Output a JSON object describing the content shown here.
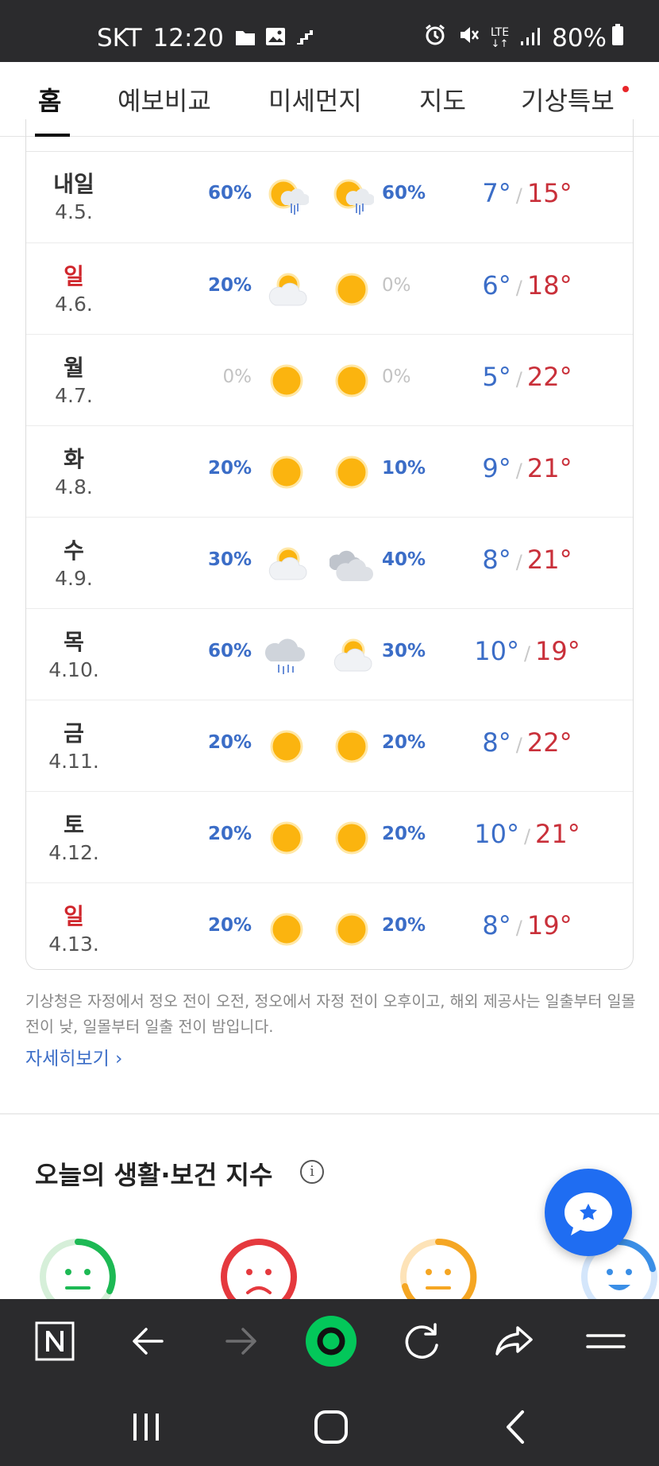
{
  "status_bar": {
    "carrier": "SKT",
    "time": "12:20",
    "network": "LTE",
    "battery": "80%"
  },
  "tabs": [
    {
      "label": "홈",
      "active": true
    },
    {
      "label": "예보비교",
      "active": false
    },
    {
      "label": "미세먼지",
      "active": false
    },
    {
      "label": "지도",
      "active": false
    },
    {
      "label": "기상특보",
      "active": false,
      "has_alert_dot": true
    }
  ],
  "forecast": {
    "rows": [
      {
        "day": "내일",
        "date": "4.5.",
        "am_pct": "60%",
        "am_icon": "cloud-rain-sun-icon",
        "pm_pct": "60%",
        "pm_icon": "cloud-rain-sun-icon",
        "low": "7°",
        "high": "15°",
        "holiday": false
      },
      {
        "day": "일",
        "date": "4.6.",
        "am_pct": "20%",
        "am_icon": "partly-cloudy-icon",
        "pm_pct": "0%",
        "pm_icon": "sun-icon",
        "low": "6°",
        "high": "18°",
        "holiday": true
      },
      {
        "day": "월",
        "date": "4.7.",
        "am_pct": "0%",
        "am_icon": "sun-icon",
        "pm_pct": "0%",
        "pm_icon": "sun-icon",
        "low": "5°",
        "high": "22°",
        "holiday": false
      },
      {
        "day": "화",
        "date": "4.8.",
        "am_pct": "20%",
        "am_icon": "sun-icon",
        "pm_pct": "10%",
        "pm_icon": "sun-icon",
        "low": "9°",
        "high": "21°",
        "holiday": false
      },
      {
        "day": "수",
        "date": "4.9.",
        "am_pct": "30%",
        "am_icon": "partly-cloudy-icon",
        "pm_pct": "40%",
        "pm_icon": "cloudy-icon",
        "low": "8°",
        "high": "21°",
        "holiday": false
      },
      {
        "day": "목",
        "date": "4.10.",
        "am_pct": "60%",
        "am_icon": "rain-icon",
        "pm_pct": "30%",
        "pm_icon": "partly-cloudy-icon",
        "low": "10°",
        "high": "19°",
        "holiday": false
      },
      {
        "day": "금",
        "date": "4.11.",
        "am_pct": "20%",
        "am_icon": "sun-icon",
        "pm_pct": "20%",
        "pm_icon": "sun-icon",
        "low": "8°",
        "high": "22°",
        "holiday": false
      },
      {
        "day": "토",
        "date": "4.12.",
        "am_pct": "20%",
        "am_icon": "sun-icon",
        "pm_pct": "20%",
        "pm_icon": "sun-icon",
        "low": "10°",
        "high": "21°",
        "holiday": false
      },
      {
        "day": "일",
        "date": "4.13.",
        "am_pct": "20%",
        "am_icon": "sun-icon",
        "pm_pct": "20%",
        "pm_icon": "sun-icon",
        "low": "8°",
        "high": "19°",
        "holiday": true
      }
    ],
    "note": "기상청은 자정에서 정오 전이 오전, 정오에서 자정 전이 오후이고, 해외 제공사는 일출부터 일몰 전이 낮, 일몰부터 일출 전이 밤입니다.",
    "more_link": "자세히보기"
  },
  "life_index": {
    "title": "오늘의 생활·보건 지수",
    "faces": [
      "neutral-face-icon",
      "sad-face-icon",
      "neutral-face-icon",
      "happy-face-icon"
    ]
  },
  "colors": {
    "low_temp": "#3b6dc7",
    "high_temp": "#c9303a",
    "holiday": "#d0262c",
    "accent_green": "#03c75a",
    "fab_blue": "#1f6df2"
  }
}
